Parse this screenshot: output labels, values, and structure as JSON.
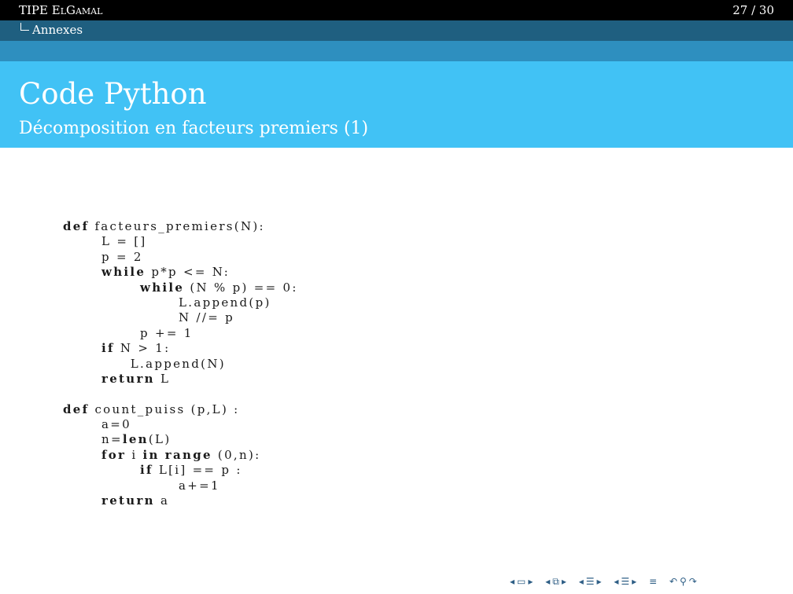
{
  "header": {
    "doc_title": "TIPE ElGamal",
    "page_counter": "27 / 30",
    "section": "Annexes"
  },
  "slide": {
    "title": "Code Python",
    "subtitle": "Décomposition en facteurs premiers (1)"
  },
  "code": {
    "lines": [
      {
        "indent": 0,
        "segments": [
          {
            "t": "def",
            "kw": true
          },
          {
            "t": " facteurs_premiers(N):"
          }
        ]
      },
      {
        "indent": 1,
        "segments": [
          {
            "t": "L = []"
          }
        ]
      },
      {
        "indent": 1,
        "segments": [
          {
            "t": "p = 2"
          }
        ]
      },
      {
        "indent": 1,
        "segments": [
          {
            "t": "while",
            "kw": true
          },
          {
            "t": " p*p <= N:"
          }
        ]
      },
      {
        "indent": 2,
        "segments": [
          {
            "t": "while",
            "kw": true
          },
          {
            "t": " (N % p) == 0:"
          }
        ]
      },
      {
        "indent": 3,
        "segments": [
          {
            "t": "L.append(p)"
          }
        ]
      },
      {
        "indent": 3,
        "segments": [
          {
            "t": "N //= p"
          }
        ]
      },
      {
        "indent": 2,
        "segments": [
          {
            "t": "p += 1"
          }
        ]
      },
      {
        "indent": 1,
        "segments": [
          {
            "t": "if",
            "kw": true
          },
          {
            "t": " N > 1:"
          }
        ]
      },
      {
        "indent": 1.75,
        "segments": [
          {
            "t": "L.append(N)"
          }
        ]
      },
      {
        "indent": 1,
        "segments": [
          {
            "t": "return",
            "kw": true
          },
          {
            "t": " L"
          }
        ]
      },
      {
        "indent": 0,
        "segments": [
          {
            "t": ""
          }
        ]
      },
      {
        "indent": 0,
        "segments": [
          {
            "t": "def",
            "kw": true
          },
          {
            "t": " count_puiss (p,L) :"
          }
        ]
      },
      {
        "indent": 1,
        "segments": [
          {
            "t": "a=0"
          }
        ]
      },
      {
        "indent": 1,
        "segments": [
          {
            "t": "n="
          },
          {
            "t": "len",
            "kw": true
          },
          {
            "t": "(L)"
          }
        ]
      },
      {
        "indent": 1,
        "segments": [
          {
            "t": "for",
            "kw": true
          },
          {
            "t": " i "
          },
          {
            "t": "in",
            "kw": true
          },
          {
            "t": " "
          },
          {
            "t": "range",
            "kw": true
          },
          {
            "t": " (0,n):"
          }
        ]
      },
      {
        "indent": 2,
        "segments": [
          {
            "t": "if",
            "kw": true
          },
          {
            "t": " L[i] == p :"
          }
        ]
      },
      {
        "indent": 3,
        "segments": [
          {
            "t": "a+=1"
          }
        ]
      },
      {
        "indent": 1,
        "segments": [
          {
            "t": "return",
            "kw": true
          },
          {
            "t": " a"
          }
        ]
      }
    ]
  },
  "nav_icons": [
    "prev-arrow-icon",
    "frame-icon",
    "next-arrow-icon",
    "prev-arrow-icon",
    "subsection-icon",
    "next-arrow-icon",
    "prev-arrow-icon",
    "section-icon",
    "next-arrow-icon",
    "prev-arrow-icon",
    "section-icon",
    "next-arrow-icon",
    "align-icon",
    "undo-icon",
    "search-icon",
    "redo-icon"
  ]
}
